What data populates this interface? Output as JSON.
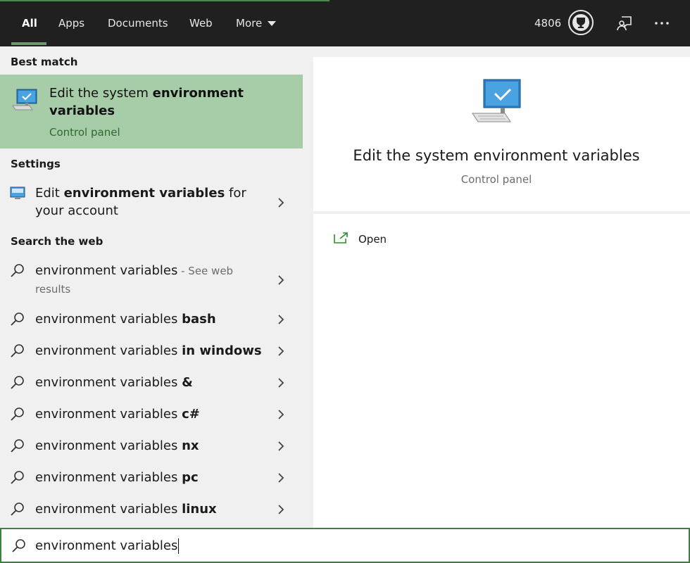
{
  "tabs": [
    {
      "label": "All",
      "active": true
    },
    {
      "label": "Apps"
    },
    {
      "label": "Documents"
    },
    {
      "label": "Web"
    },
    {
      "label": "More"
    }
  ],
  "points": "4806",
  "sections": {
    "best_match": "Best match",
    "settings": "Settings",
    "search_web": "Search the web"
  },
  "best_match": {
    "title_plain": "Edit the system ",
    "title_bold": "environment variables",
    "subtitle": "Control panel"
  },
  "settings_item": {
    "prefix": "Edit ",
    "bold": "environment variables",
    "suffix": " for your account"
  },
  "web_results": [
    {
      "plain": "environment variables",
      "bold": "",
      "suffix": " - See web results"
    },
    {
      "plain": "environment variables ",
      "bold": "bash"
    },
    {
      "plain": "environment variables ",
      "bold": "in windows"
    },
    {
      "plain": "environment variables ",
      "bold": "&"
    },
    {
      "plain": "environment variables ",
      "bold": "c#"
    },
    {
      "plain": "environment variables ",
      "bold": "nx"
    },
    {
      "plain": "environment variables ",
      "bold": "pc"
    },
    {
      "plain": "environment variables ",
      "bold": "linux"
    }
  ],
  "detail": {
    "title": "Edit the system environment variables",
    "subtitle": "Control panel",
    "open_label": "Open"
  },
  "search": {
    "value": "environment variables"
  },
  "colors": {
    "highlight": "#a7cda8",
    "accent_green": "#2e6b30",
    "topbar": "#202020"
  }
}
